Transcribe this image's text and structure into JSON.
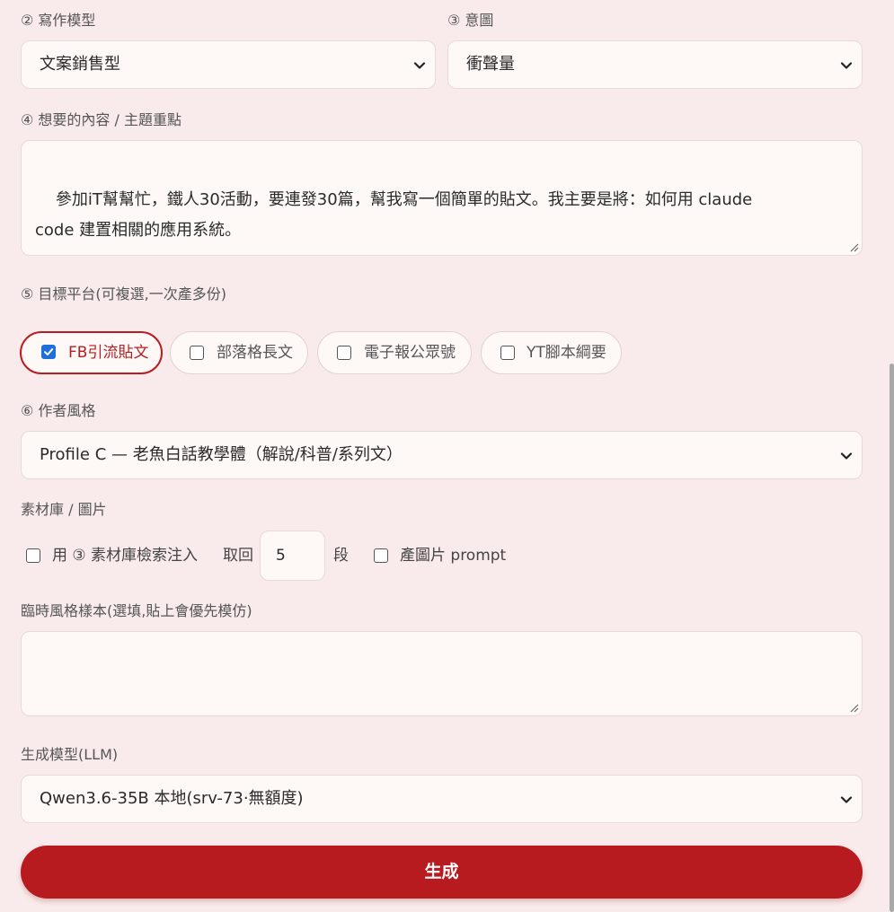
{
  "writing_model": {
    "label": "② 寫作模型",
    "selected": "文案銷售型"
  },
  "intent": {
    "label": "③ 意圖",
    "selected": "衝聲量"
  },
  "content": {
    "label": "④ 想要的內容 / 主題重點",
    "value": "參加iT幫幫忙，鐵人30活動，要連發30篇，幫我寫一個簡單的貼文。我主要是將：如何用 claude\ncode 建置相關的應用系統。"
  },
  "platforms": {
    "label": "⑤ 目標平台(可複選,一次產多份)",
    "items": [
      {
        "label": "FB引流貼文",
        "checked": true
      },
      {
        "label": "部落格長文",
        "checked": false
      },
      {
        "label": "電子報公眾號",
        "checked": false
      },
      {
        "label": "YT腳本綱要",
        "checked": false
      }
    ]
  },
  "author_style": {
    "label": "⑥ 作者風格",
    "selected": "Profile C — 老魚白話教學體（解說/科普/系列文）"
  },
  "materials": {
    "label": "素材庫 / 圖片",
    "use_search_label": "用 ③ 素材庫檢索注入",
    "use_search_checked": false,
    "take_label": "取回",
    "take_count": "5",
    "unit_label": "段",
    "image_prompt_label": "產圖片 prompt",
    "image_prompt_checked": false
  },
  "temp_style": {
    "label": "臨時風格樣本(選填,貼上會優先模仿)",
    "value": ""
  },
  "llm": {
    "label": "生成模型(LLM)",
    "selected": "Qwen3.6-35B 本地(srv-73·無額度)"
  },
  "generate_button": "生成",
  "colors": {
    "background": "#f9ebeb",
    "accent": "#b81b1f",
    "checkbox_checked": "#1e6fd9"
  },
  "icons": {
    "select_arrow": "chevron-down-icon",
    "checkbox_check": "check-icon",
    "resize_handle": "resize-grip-icon"
  }
}
